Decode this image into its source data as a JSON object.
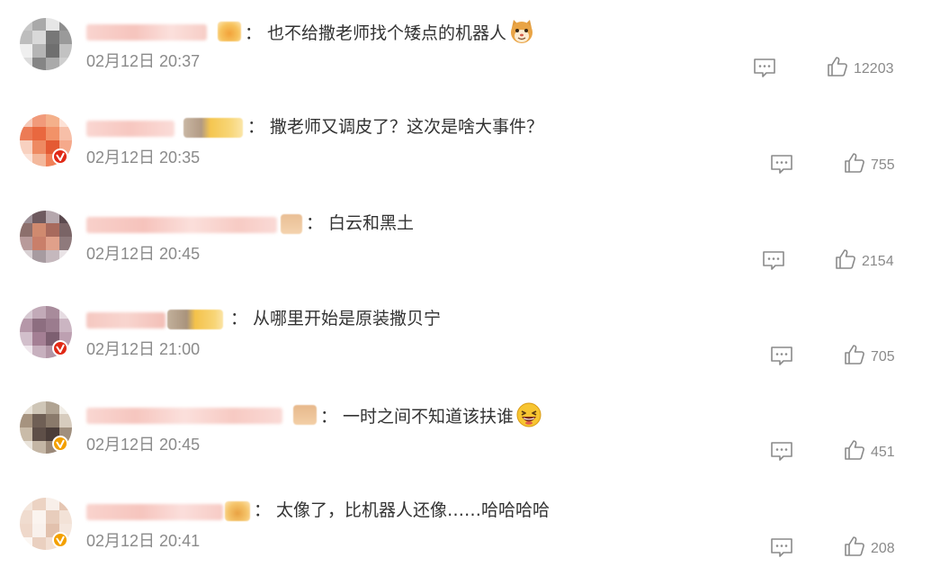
{
  "comments": [
    {
      "text": "也不给撒老师找个矮点的机器人",
      "emoji": "cat-face-emoji",
      "time": "02月12日 20:37",
      "likes": "12203",
      "verified": "none",
      "avatar_colors": [
        "#c8c8c8",
        "#a9a9a9",
        "#e6e6e6",
        "#8e8e8e",
        "#bdbdbd",
        "#d9d9d9",
        "#777777",
        "#9a9a9a",
        "#efefef",
        "#b5b5b5",
        "#6f6f6f",
        "#c2c2c2",
        "#dcdcdc",
        "#858585",
        "#aaaaaa",
        "#cfcfcf"
      ]
    },
    {
      "text": "撒老师又调皮了？这次是啥大事件？",
      "emoji": "",
      "time": "02月12日 20:35",
      "likes": "755",
      "verified": "red",
      "avatar_colors": [
        "#f6c9b8",
        "#f19a7a",
        "#f4b08a",
        "#fde2d6",
        "#ec7b55",
        "#e9683f",
        "#f29268",
        "#f7bfa8",
        "#f8d1c0",
        "#ee8a62",
        "#e45a33",
        "#f5a98b",
        "#fbe3d9",
        "#f3b89c",
        "#f08058",
        "#fad4c6"
      ]
    },
    {
      "text": "白云和黑土",
      "emoji": "",
      "time": "02月12日 20:45",
      "likes": "2154",
      "verified": "none",
      "avatar_colors": [
        "#9c8f96",
        "#6e5a5f",
        "#b5a7ad",
        "#5b4a4f",
        "#8c6f6c",
        "#d08a6f",
        "#a86a5d",
        "#7a6466",
        "#b89a9a",
        "#c97f6a",
        "#e0a08a",
        "#8f7a7c",
        "#d8d0d3",
        "#a79ba0",
        "#c5b8bd",
        "#e9e3e6"
      ]
    },
    {
      "text": "从哪里开始是原装撒贝宁",
      "emoji": "",
      "time": "02月12日 21:00",
      "likes": "705",
      "verified": "red",
      "avatar_colors": [
        "#d7c9d2",
        "#c2aab8",
        "#a88b9b",
        "#e6dce2",
        "#b597a8",
        "#8d6e80",
        "#9b7c8e",
        "#cbb5c2",
        "#d2bfcb",
        "#a47f94",
        "#7d5f71",
        "#bda0b1",
        "#efe7ec",
        "#c7b0be",
        "#b296a6",
        "#dccfd7"
      ]
    },
    {
      "text": "一时之间不知道该扶谁",
      "emoji": "laughing-emoji",
      "time": "02月12日 20:45",
      "likes": "451",
      "verified": "yellow",
      "avatar_colors": [
        "#e8e2d8",
        "#cfc6b7",
        "#b0a392",
        "#f1ede6",
        "#a6937f",
        "#6f5f55",
        "#8a7a6b",
        "#d7ccbe",
        "#c9bba8",
        "#5e4f48",
        "#4a3d39",
        "#a08f7e",
        "#eae4db",
        "#c4b6a5",
        "#9a8878",
        "#dfd6ca"
      ]
    },
    {
      "text": "太像了，比机器人还像……哈哈哈哈",
      "emoji": "",
      "time": "02月12日 20:41",
      "likes": "208",
      "verified": "yellow",
      "avatar_colors": [
        "#f4e6dc",
        "#ecd3c3",
        "#f8efe9",
        "#e5c6b3",
        "#f0dccf",
        "#fbf4ef",
        "#e8cdbc",
        "#f3e2d7",
        "#efd8ca",
        "#f9f1ec",
        "#e2c1ad",
        "#f5e7de",
        "#fcf7f3",
        "#ead0c0",
        "#f2dfd3",
        "#f7ebe3"
      ]
    }
  ]
}
